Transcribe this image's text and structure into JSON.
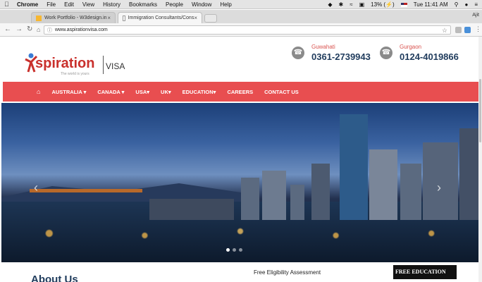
{
  "os_menubar": {
    "app": "Chrome",
    "items": [
      "File",
      "Edit",
      "View",
      "History",
      "Bookmarks",
      "People",
      "Window",
      "Help"
    ],
    "battery": "13% (⚡)",
    "clock": "Tue 11:41 AM"
  },
  "browser": {
    "tabs": [
      {
        "title": "Work Portfolio - W3design.in"
      },
      {
        "title": "Immigration Consultants/Cons"
      }
    ],
    "user": "Ajit",
    "url": "www.aspirationvisa.com"
  },
  "site": {
    "logo_text": "spiration",
    "logo_visa": "VISA",
    "logo_tagline": "The world is yours",
    "contacts": [
      {
        "city": "Guwahati",
        "phone": "0361-2739943"
      },
      {
        "city": "Gurgaon",
        "phone": "0124-4019866"
      }
    ],
    "nav": [
      "AUSTRALIA ▾",
      "CANADA ▾",
      "USA▾",
      "UK▾",
      "EDUCATION▾",
      "CAREERS",
      "CONTACT US"
    ],
    "about_heading": "About Us",
    "eligibility": "Free Eligibility Assessment",
    "free_education": "FREE EDUCATION",
    "slider_dots": 3,
    "active_dot": 0
  },
  "colors": {
    "nav_bg": "#e84e50",
    "brand_red": "#c9302c",
    "phone_text": "#1f3b5c"
  }
}
